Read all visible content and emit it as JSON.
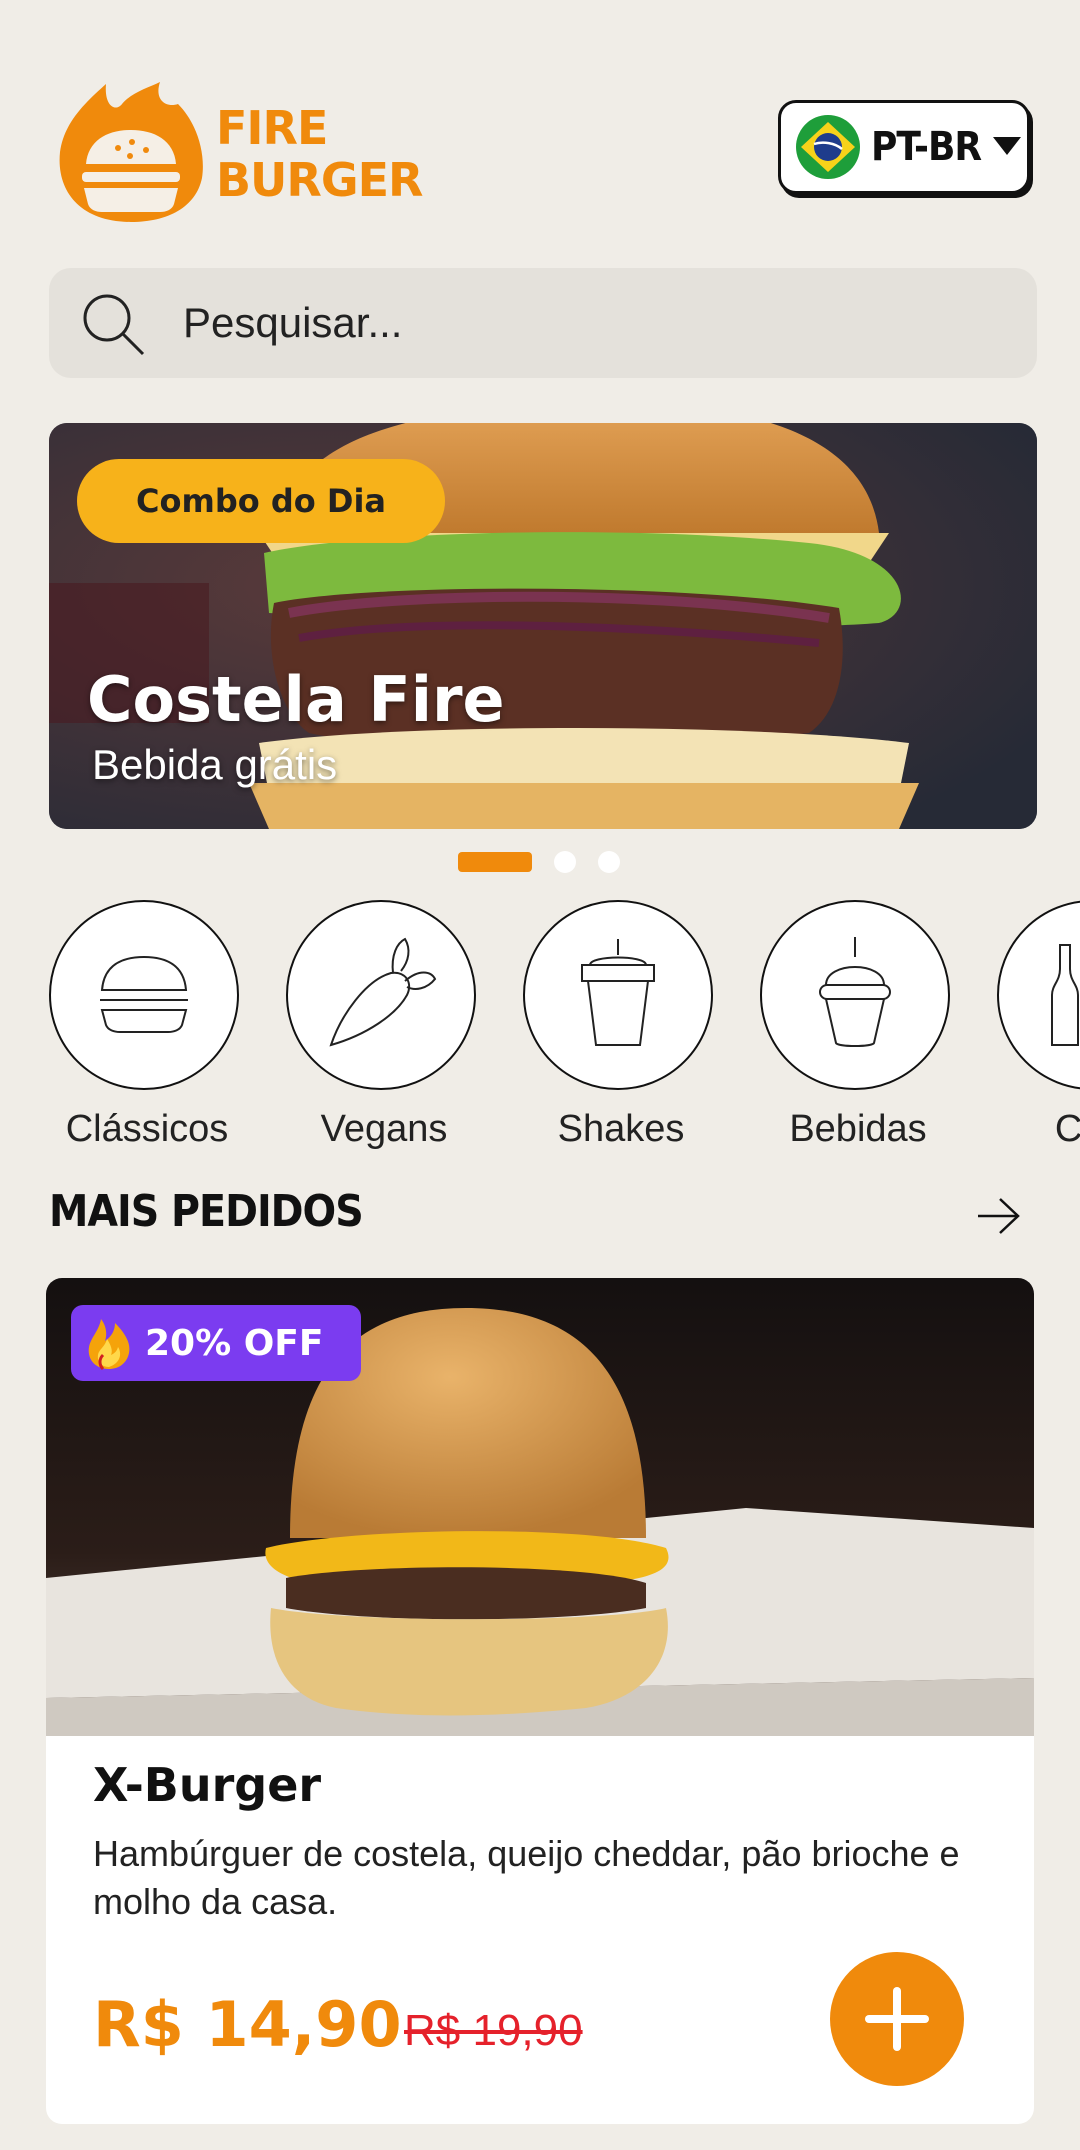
{
  "brand": {
    "line1": "FIRE",
    "line2": "BURGER",
    "color": "#F08A0C"
  },
  "language": {
    "code": "PT-BR",
    "flag_icon": "brazil-flag-icon"
  },
  "search": {
    "placeholder": "Pesquisar..."
  },
  "banner": {
    "badge": "Combo do Dia",
    "title": "Costela Fire",
    "subtitle": "Bebida grátis",
    "slides_total": 3,
    "active_slide": 1
  },
  "categories": [
    {
      "label": "Clássicos",
      "icon": "burger-icon"
    },
    {
      "label": "Vegans",
      "icon": "carrot-icon"
    },
    {
      "label": "Shakes",
      "icon": "shake-cup-icon"
    },
    {
      "label": "Bebidas",
      "icon": "drink-cup-icon"
    },
    {
      "label": "Com",
      "icon": "bottle-icon"
    }
  ],
  "section": {
    "title": "MAIS PEDIDOS"
  },
  "product": {
    "badge": "20% OFF",
    "name": "X-Burger",
    "description": "Hambúrguer de costela, queijo cheddar, pão brioche e molho da casa.",
    "price": "R$ 14,90",
    "old_price": "R$ 19,90"
  },
  "colors": {
    "accent": "#F08A0C",
    "badge_yellow": "#F7B21A",
    "offer_purple": "#7B3CF0",
    "strike_red": "#E5212B",
    "background": "#F0EDE7"
  }
}
